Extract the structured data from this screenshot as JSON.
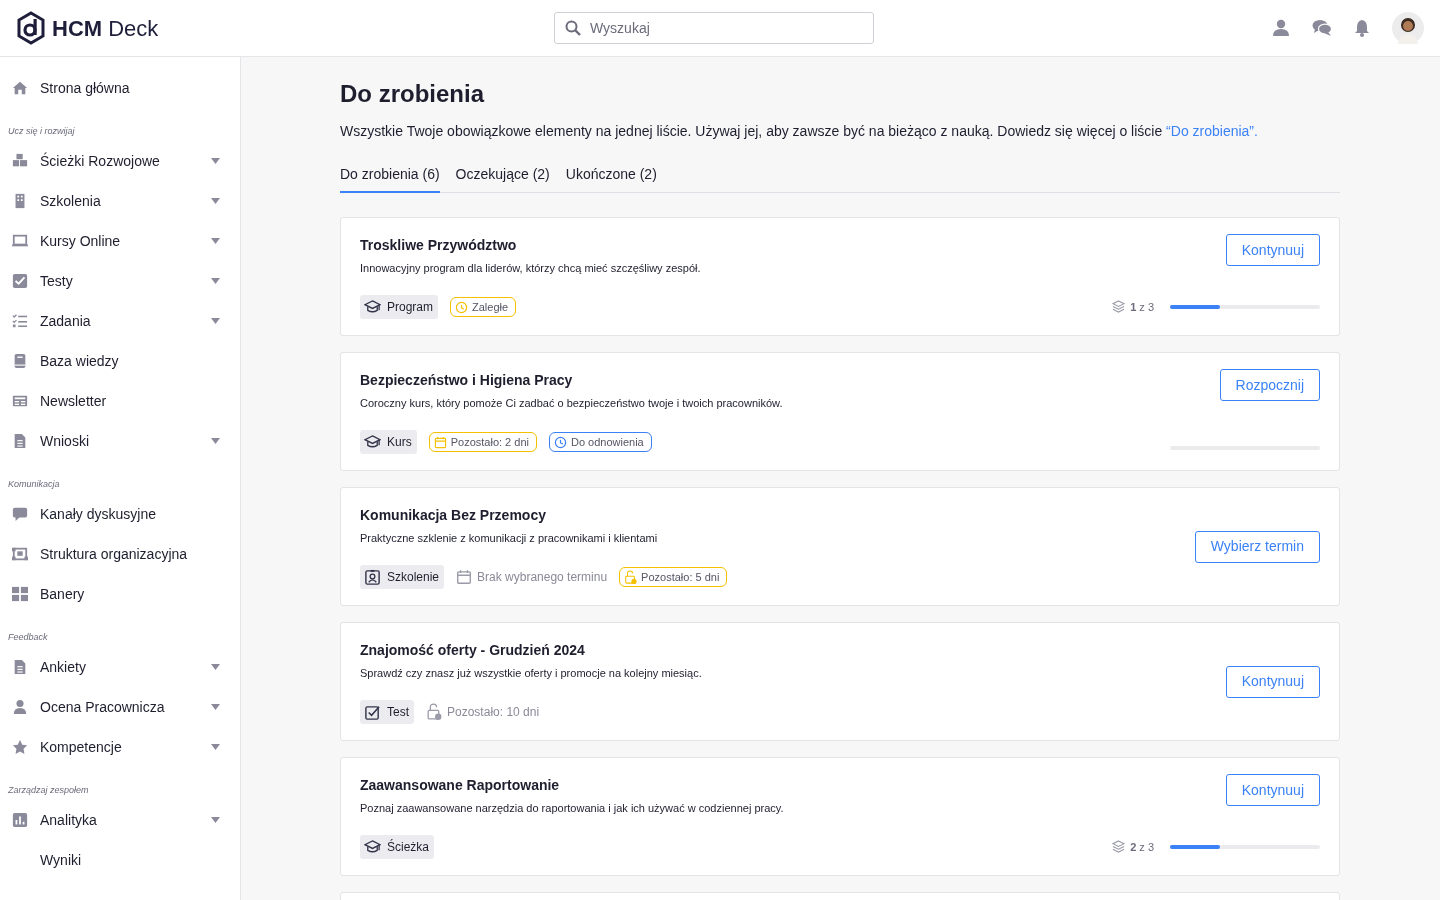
{
  "header": {
    "logo": "**HCM** Deck",
    "search": {
      "placeholder": "Wyszukaj"
    }
  },
  "sidebar": {
    "items": [
      {
        "kind": "item",
        "label": "Strona główna",
        "expandable": false
      },
      {
        "kind": "section",
        "label": "Ucz się i rozwijaj"
      },
      {
        "kind": "item",
        "label": "Ścieżki Rozwojowe",
        "expandable": true
      },
      {
        "kind": "item",
        "label": "Szkolenia",
        "expandable": true
      },
      {
        "kind": "item",
        "label": "Kursy Online",
        "expandable": true
      },
      {
        "kind": "item",
        "label": "Testy",
        "expandable": true
      },
      {
        "kind": "item",
        "label": "Zadania",
        "expandable": true
      },
      {
        "kind": "item",
        "label": "Baza wiedzy",
        "expandable": false
      },
      {
        "kind": "item",
        "label": "Newsletter",
        "expandable": false
      },
      {
        "kind": "item",
        "label": "Wnioski",
        "expandable": true
      },
      {
        "kind": "section",
        "label": "Komunikacja"
      },
      {
        "kind": "item",
        "label": "Kanały dyskusyjne",
        "expandable": false
      },
      {
        "kind": "item",
        "label": "Struktura organizacyjna",
        "expandable": false
      },
      {
        "kind": "item",
        "label": "Banery",
        "expandable": false
      },
      {
        "kind": "section",
        "label": "Feedback"
      },
      {
        "kind": "item",
        "label": "Ankiety",
        "expandable": true
      },
      {
        "kind": "item",
        "label": "Ocena Pracownicza",
        "expandable": true
      },
      {
        "kind": "item",
        "label": "Kompetencje",
        "expandable": true
      },
      {
        "kind": "section",
        "label": "Zarządzaj zespołem"
      },
      {
        "kind": "item",
        "label": "Analityka",
        "expandable": true
      },
      {
        "kind": "subitem",
        "label": "Wyniki"
      }
    ]
  },
  "page": {
    "title": "Do zrobienia",
    "intro": "Wszystkie Twoje obowiązkowe elementy na jednej liście. Używaj jej, aby zawsze być na bieżąco z nauką. Dowiedz się więcej o liście",
    "intro_link": "“Do zrobienia”.",
    "tabs": [
      {
        "label": "Do zrobienia (6)",
        "selected": true
      },
      {
        "label": "Oczekujące (2)",
        "selected": false
      },
      {
        "label": "Ukończone (2)",
        "selected": false
      }
    ],
    "cards": [
      {
        "title": "Troskliwe Przywództwo",
        "description": "Innowacyjny program dla liderów, którzy chcą mieć szczęśliwy zespół.",
        "type": {
          "kind": "program",
          "label": "Program"
        },
        "tags": [
          {
            "kind": "overdue",
            "label": "Zaległe",
            "color": "#f5c000"
          }
        ],
        "button": "Kontynuuj",
        "progress": {
          "reading": "**1** z 3",
          "level": 0.33
        }
      },
      {
        "title": "Bezpieczeństwo i Higiena Pracy",
        "description": "Coroczny kurs, który pomoże Ci zadbać o bezpieczeństwo twoje i twoich pracowników.",
        "type": {
          "kind": "course",
          "label": "Kurs"
        },
        "tags": [
          {
            "kind": "remaining",
            "label": "Pozostało: 2 dni",
            "color": "#f5c000"
          },
          {
            "kind": "renewal",
            "label": "Do odnowienia",
            "color": "#3b82f6"
          }
        ],
        "button": "Rozpocznij",
        "progress": {
          "level": 0
        }
      },
      {
        "title": "Komunikacja Bez Przemocy",
        "description": "Praktyczne szklenie z komunikacji z pracownikami i klientami",
        "type": {
          "kind": "training",
          "label": "Szkolenie"
        },
        "tags": [
          {
            "kind": "no_date",
            "label": "Brak wybranego terminu"
          },
          {
            "kind": "locked",
            "label": "Pozostało: 5 dni",
            "color": "#f5c000"
          }
        ],
        "button": "Wybierz termin"
      },
      {
        "title": "Znajomość oferty - Grudzień 2024",
        "description": "Sprawdź czy znasz już wszystkie oferty i promocje na kolejny miesiąc.",
        "type": {
          "kind": "test",
          "label": "Test"
        },
        "tags": [
          {
            "kind": "locked",
            "label": "Pozostało: 10 dni"
          }
        ],
        "button": "Kontynuuj"
      },
      {
        "title": "Zaawansowane Raportowanie",
        "description": "Poznaj zaawansowane narzędzia do raportowania i jak ich używać w codziennej pracy.",
        "type": {
          "kind": "path",
          "label": "Ścieżka"
        },
        "button": "Kontynuuj",
        "progress": {
          "reading": "**2** z 3",
          "level": 0.33
        }
      }
    ]
  }
}
